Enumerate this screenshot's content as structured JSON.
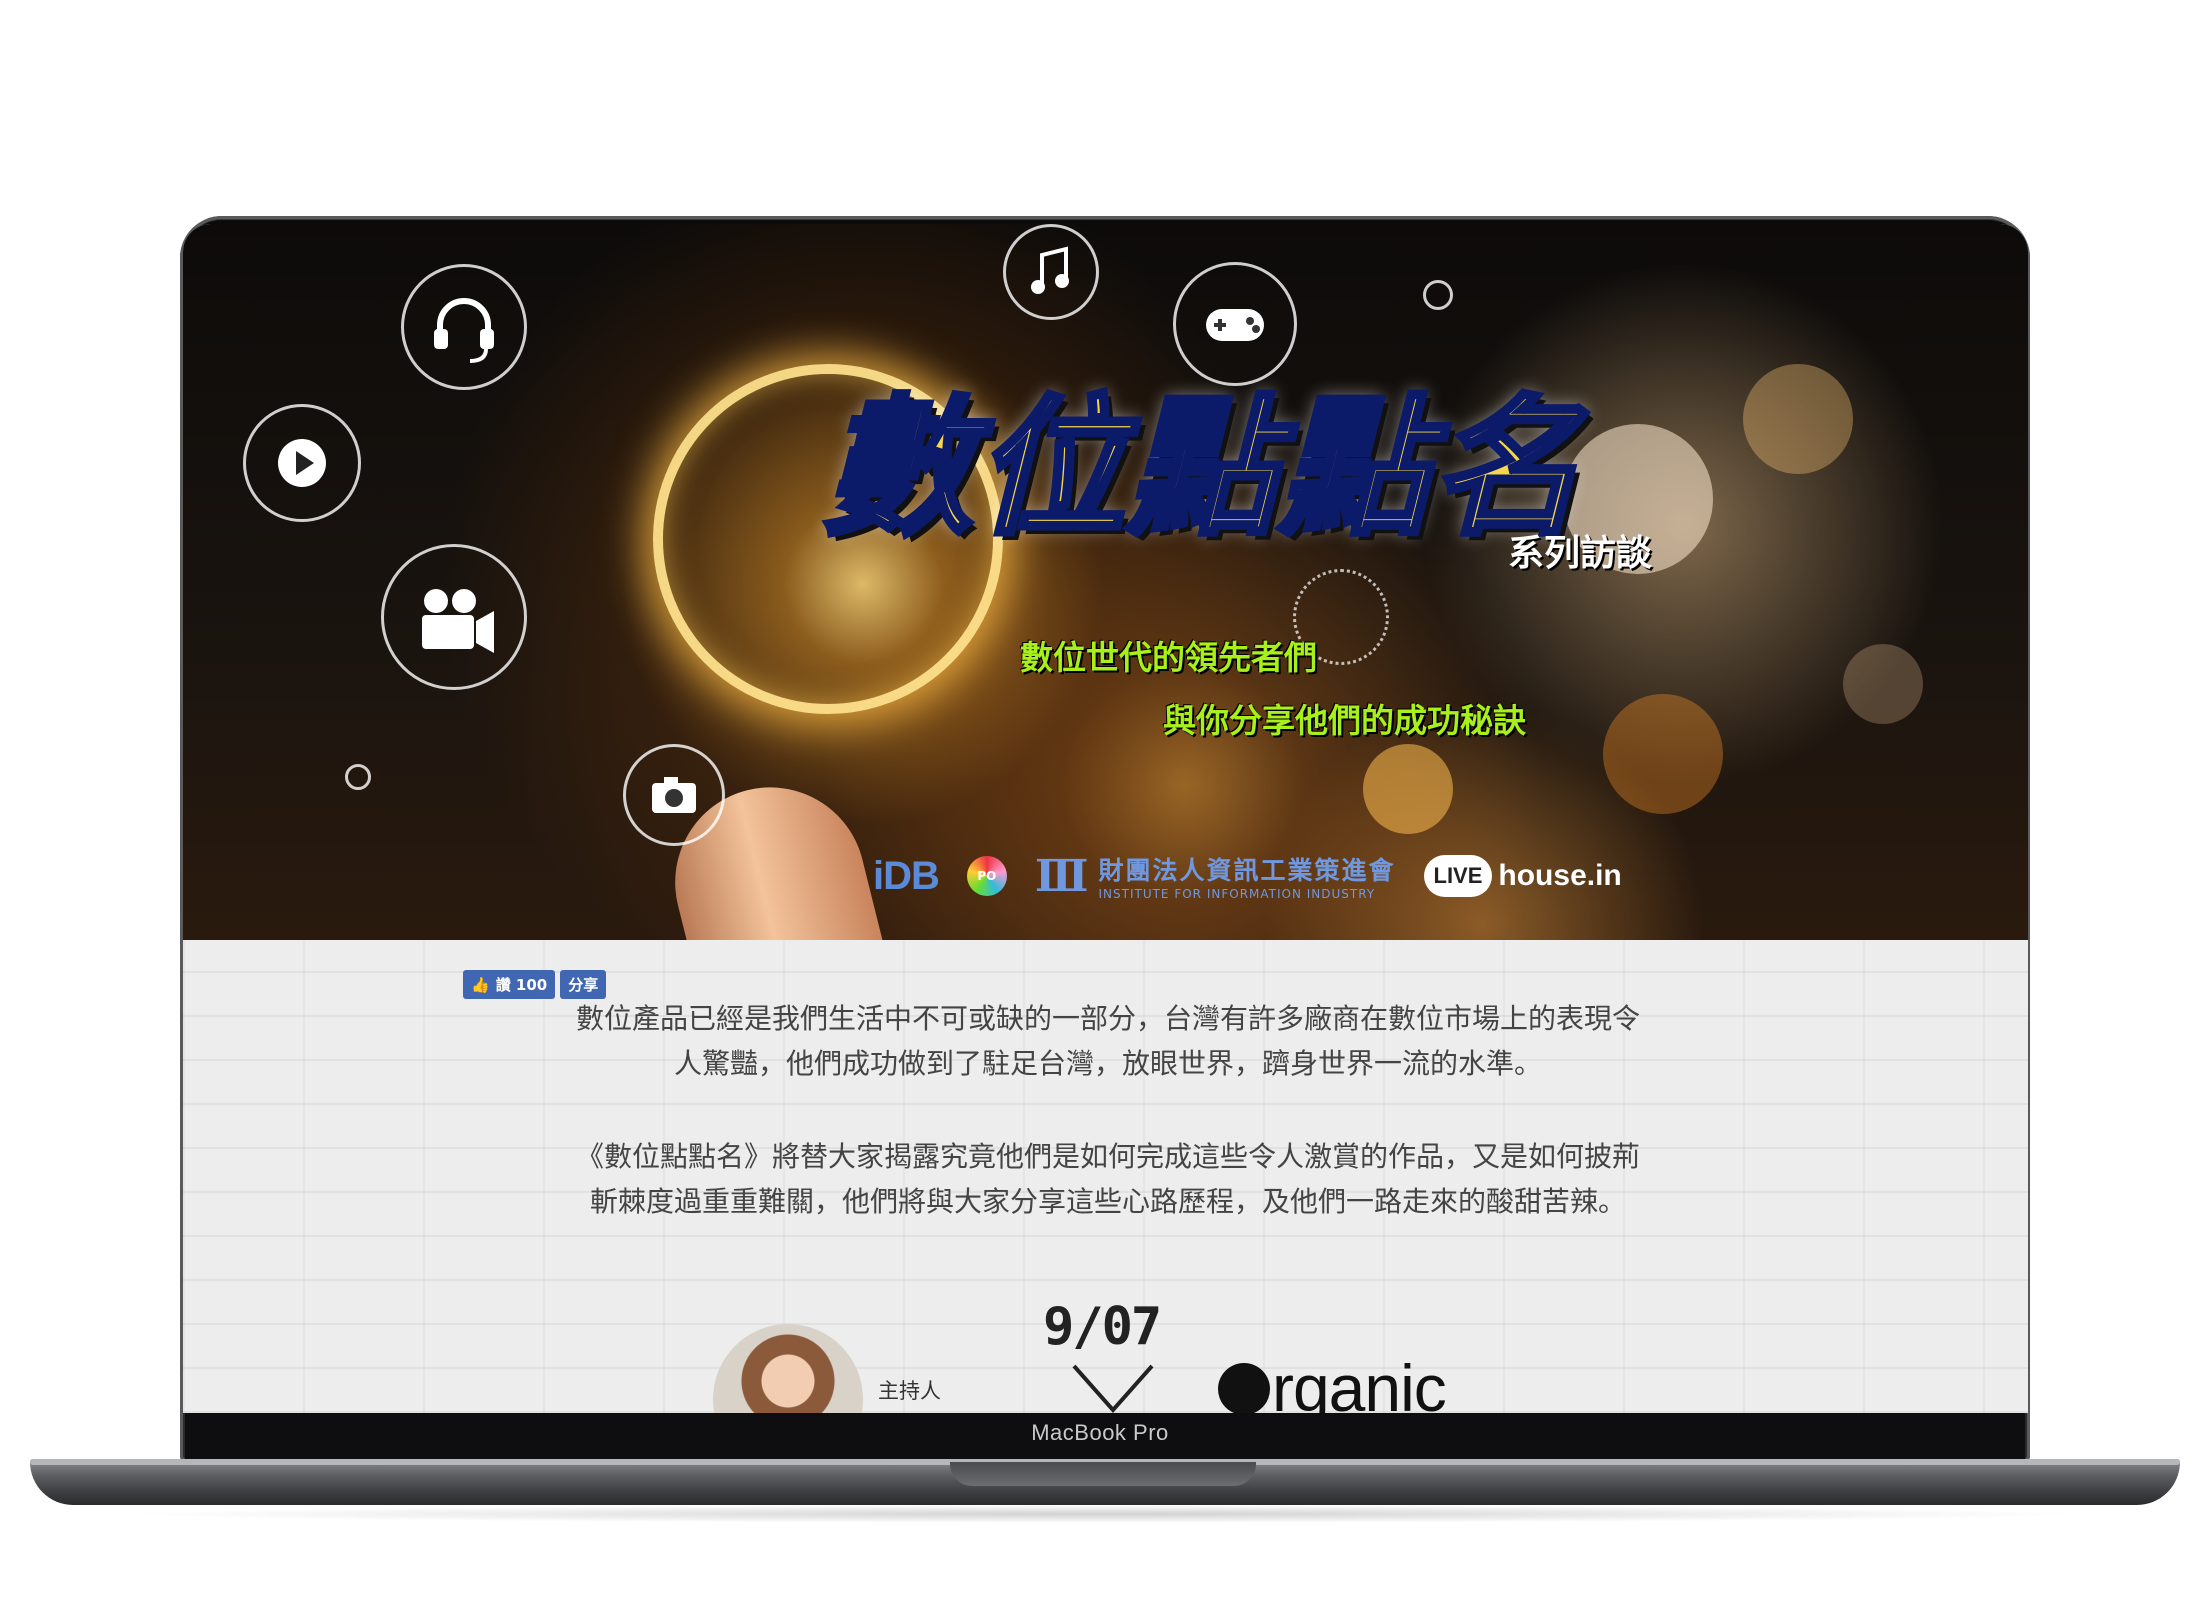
{
  "hero": {
    "title": "數位點點名",
    "subtitle": "系列訪談",
    "tagline_1": "數位世代的領先者們",
    "tagline_2": "與你分享他們的成功秘訣",
    "icons": [
      "headset-icon",
      "play-icon",
      "video-camera-icon",
      "camera-icon",
      "music-note-icon",
      "gamepad-icon"
    ],
    "logos": {
      "idb": "iDB",
      "dpo": "PO",
      "iii_zh": "財團法人資訊工業策進會",
      "iii_en": "INSTITUTE FOR INFORMATION INDUSTRY",
      "live_badge": "LIVE",
      "live_text": "house.in"
    }
  },
  "facebook": {
    "like_label": "讚 100",
    "share_label": "分享"
  },
  "intro": {
    "paragraph_1_line_1": "數位產品已經是我們生活中不可或缺的一部分，台灣有許多廠商在數位市場上的表現令",
    "paragraph_1_line_2": "人驚豔，他們成功做到了駐足台灣，放眼世界，躋身世界一流的水準。",
    "paragraph_2_line_1": "《數位點點名》將替大家揭露究竟他們是如何完成這些令人激賞的作品，又是如何披荊",
    "paragraph_2_line_2": "斬棘度過重重難關，他們將與大家分享這些心路歷程，及他們一路走來的酸甜苦辣。"
  },
  "episode": {
    "date": "9/07",
    "host_label": "主持人",
    "brand": "rganic"
  },
  "device": {
    "label": "MacBook Pro"
  },
  "colors": {
    "title_fill": "#f7d64a",
    "tagline": "#a8f01a",
    "facebook": "#4267b2"
  }
}
